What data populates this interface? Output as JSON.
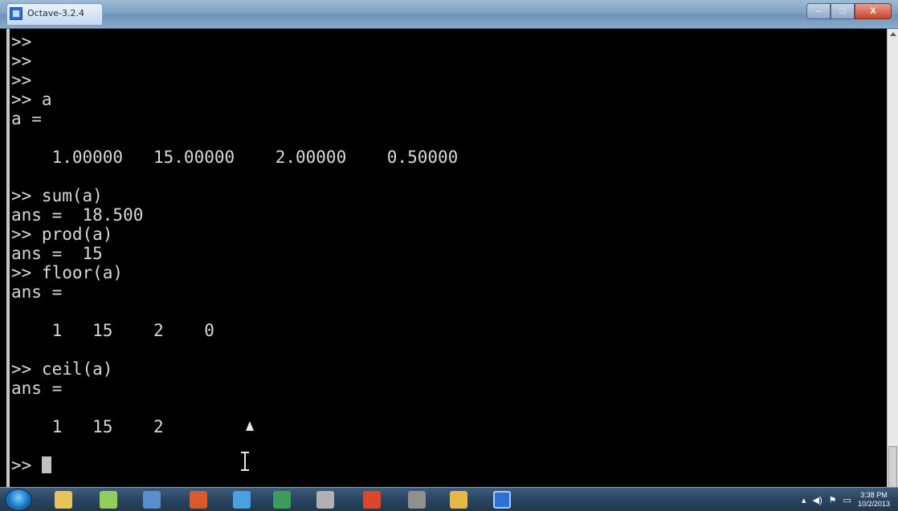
{
  "window": {
    "title": "Octave-3.2.4",
    "controls": {
      "minimize": "–",
      "maximize": "□",
      "close": "X"
    }
  },
  "console": {
    "lines": [
      ">>",
      ">>",
      ">>",
      ">> a",
      "a =",
      "",
      "    1.00000   15.00000    2.00000    0.50000",
      "",
      ">> sum(a)",
      "ans =  18.500",
      ">> prod(a)",
      "ans =  15",
      ">> floor(a)",
      "ans =",
      "",
      "    1   15    2    0",
      "",
      ">> ceil(a)",
      "ans =",
      "",
      "    1   15    2",
      "",
      ">> "
    ]
  },
  "taskbar": {
    "icons": [
      {
        "name": "explorer-icon",
        "color": "#e8c35a"
      },
      {
        "name": "sticky-notes-icon",
        "color": "#8fcf5a"
      },
      {
        "name": "network-icon",
        "color": "#5a8fcf"
      },
      {
        "name": "powerpoint-icon",
        "color": "#d95b2a"
      },
      {
        "name": "app-icon-5",
        "color": "#4aa0e0"
      },
      {
        "name": "app-icon-6",
        "color": "#3c9c5a"
      },
      {
        "name": "app-icon-7",
        "color": "#b0b0b0"
      },
      {
        "name": "chrome-icon",
        "color": "#e0452a"
      },
      {
        "name": "webcam-icon",
        "color": "#909090"
      },
      {
        "name": "app-icon-10",
        "color": "#e6b84a"
      },
      {
        "name": "octave-taskbar-icon",
        "color": "#2e6fd8"
      }
    ],
    "clock_time": "3:38 PM",
    "clock_date": "10/2/2013"
  }
}
